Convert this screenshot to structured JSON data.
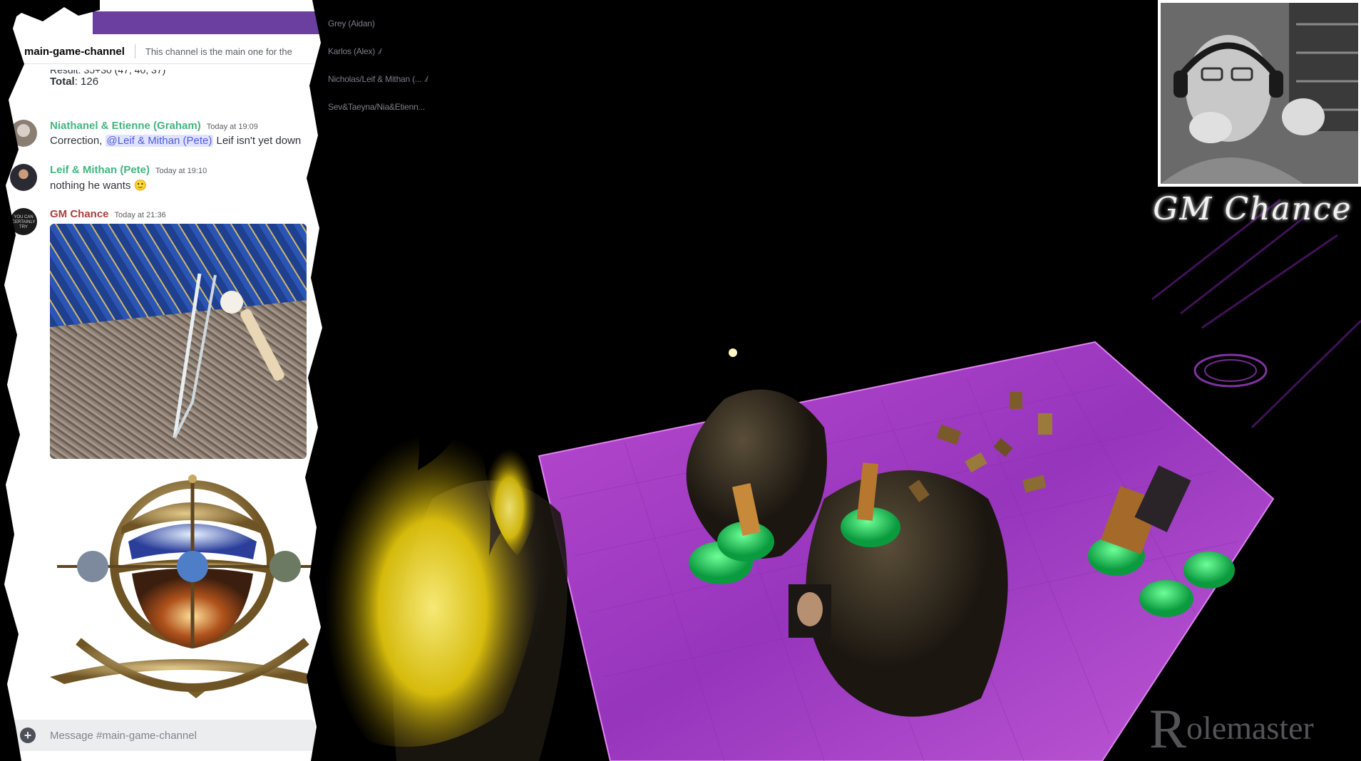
{
  "discord": {
    "channel_name": "main-game-channel",
    "channel_topic": "This channel is the main one for the",
    "partial_result_line": "Result: 35+30 (47, 40, 37)",
    "total_label": "Total",
    "total_value": ": 126",
    "messages": [
      {
        "author": "Niathanel & Etienne (Graham)",
        "author_color": "#43b581",
        "time": "Today at 19:09",
        "text_before": "Correction, ",
        "mention": "@Leif & Mithan (Pete)",
        "text_after": " Leif isn't yet down"
      },
      {
        "author": "Leif & Mithan (Pete)",
        "author_color": "#43b581",
        "time": "Today at 19:10",
        "text": "nothing he wants",
        "emoji": "🙂"
      },
      {
        "author": "GM Chance",
        "author_color": "#a84040",
        "time": "Today at 21:36",
        "avatar_text": "YOU CAN CERTAINLY TRY"
      }
    ],
    "input_placeholder": "Message #main-game-channel"
  },
  "voice_channel": {
    "members": [
      {
        "name": "Grey (Aidan)",
        "muted": false
      },
      {
        "name": "Karlos (Alex)",
        "muted": true
      },
      {
        "name": "Nicholas/Leif & Mithan (...",
        "muted": true
      },
      {
        "name": "Sev&Taeyna/Nia&Etienn...",
        "muted": false
      }
    ]
  },
  "overlay": {
    "gm_title": "GM Chance",
    "watermark_initial": "R",
    "watermark_rest": "olemaster"
  },
  "colors": {
    "discord_accent": "#6b3fa0",
    "scene_magenta": "#b03ad6",
    "fire_yellow": "#e6d20a",
    "token_green": "#1bd35a"
  }
}
